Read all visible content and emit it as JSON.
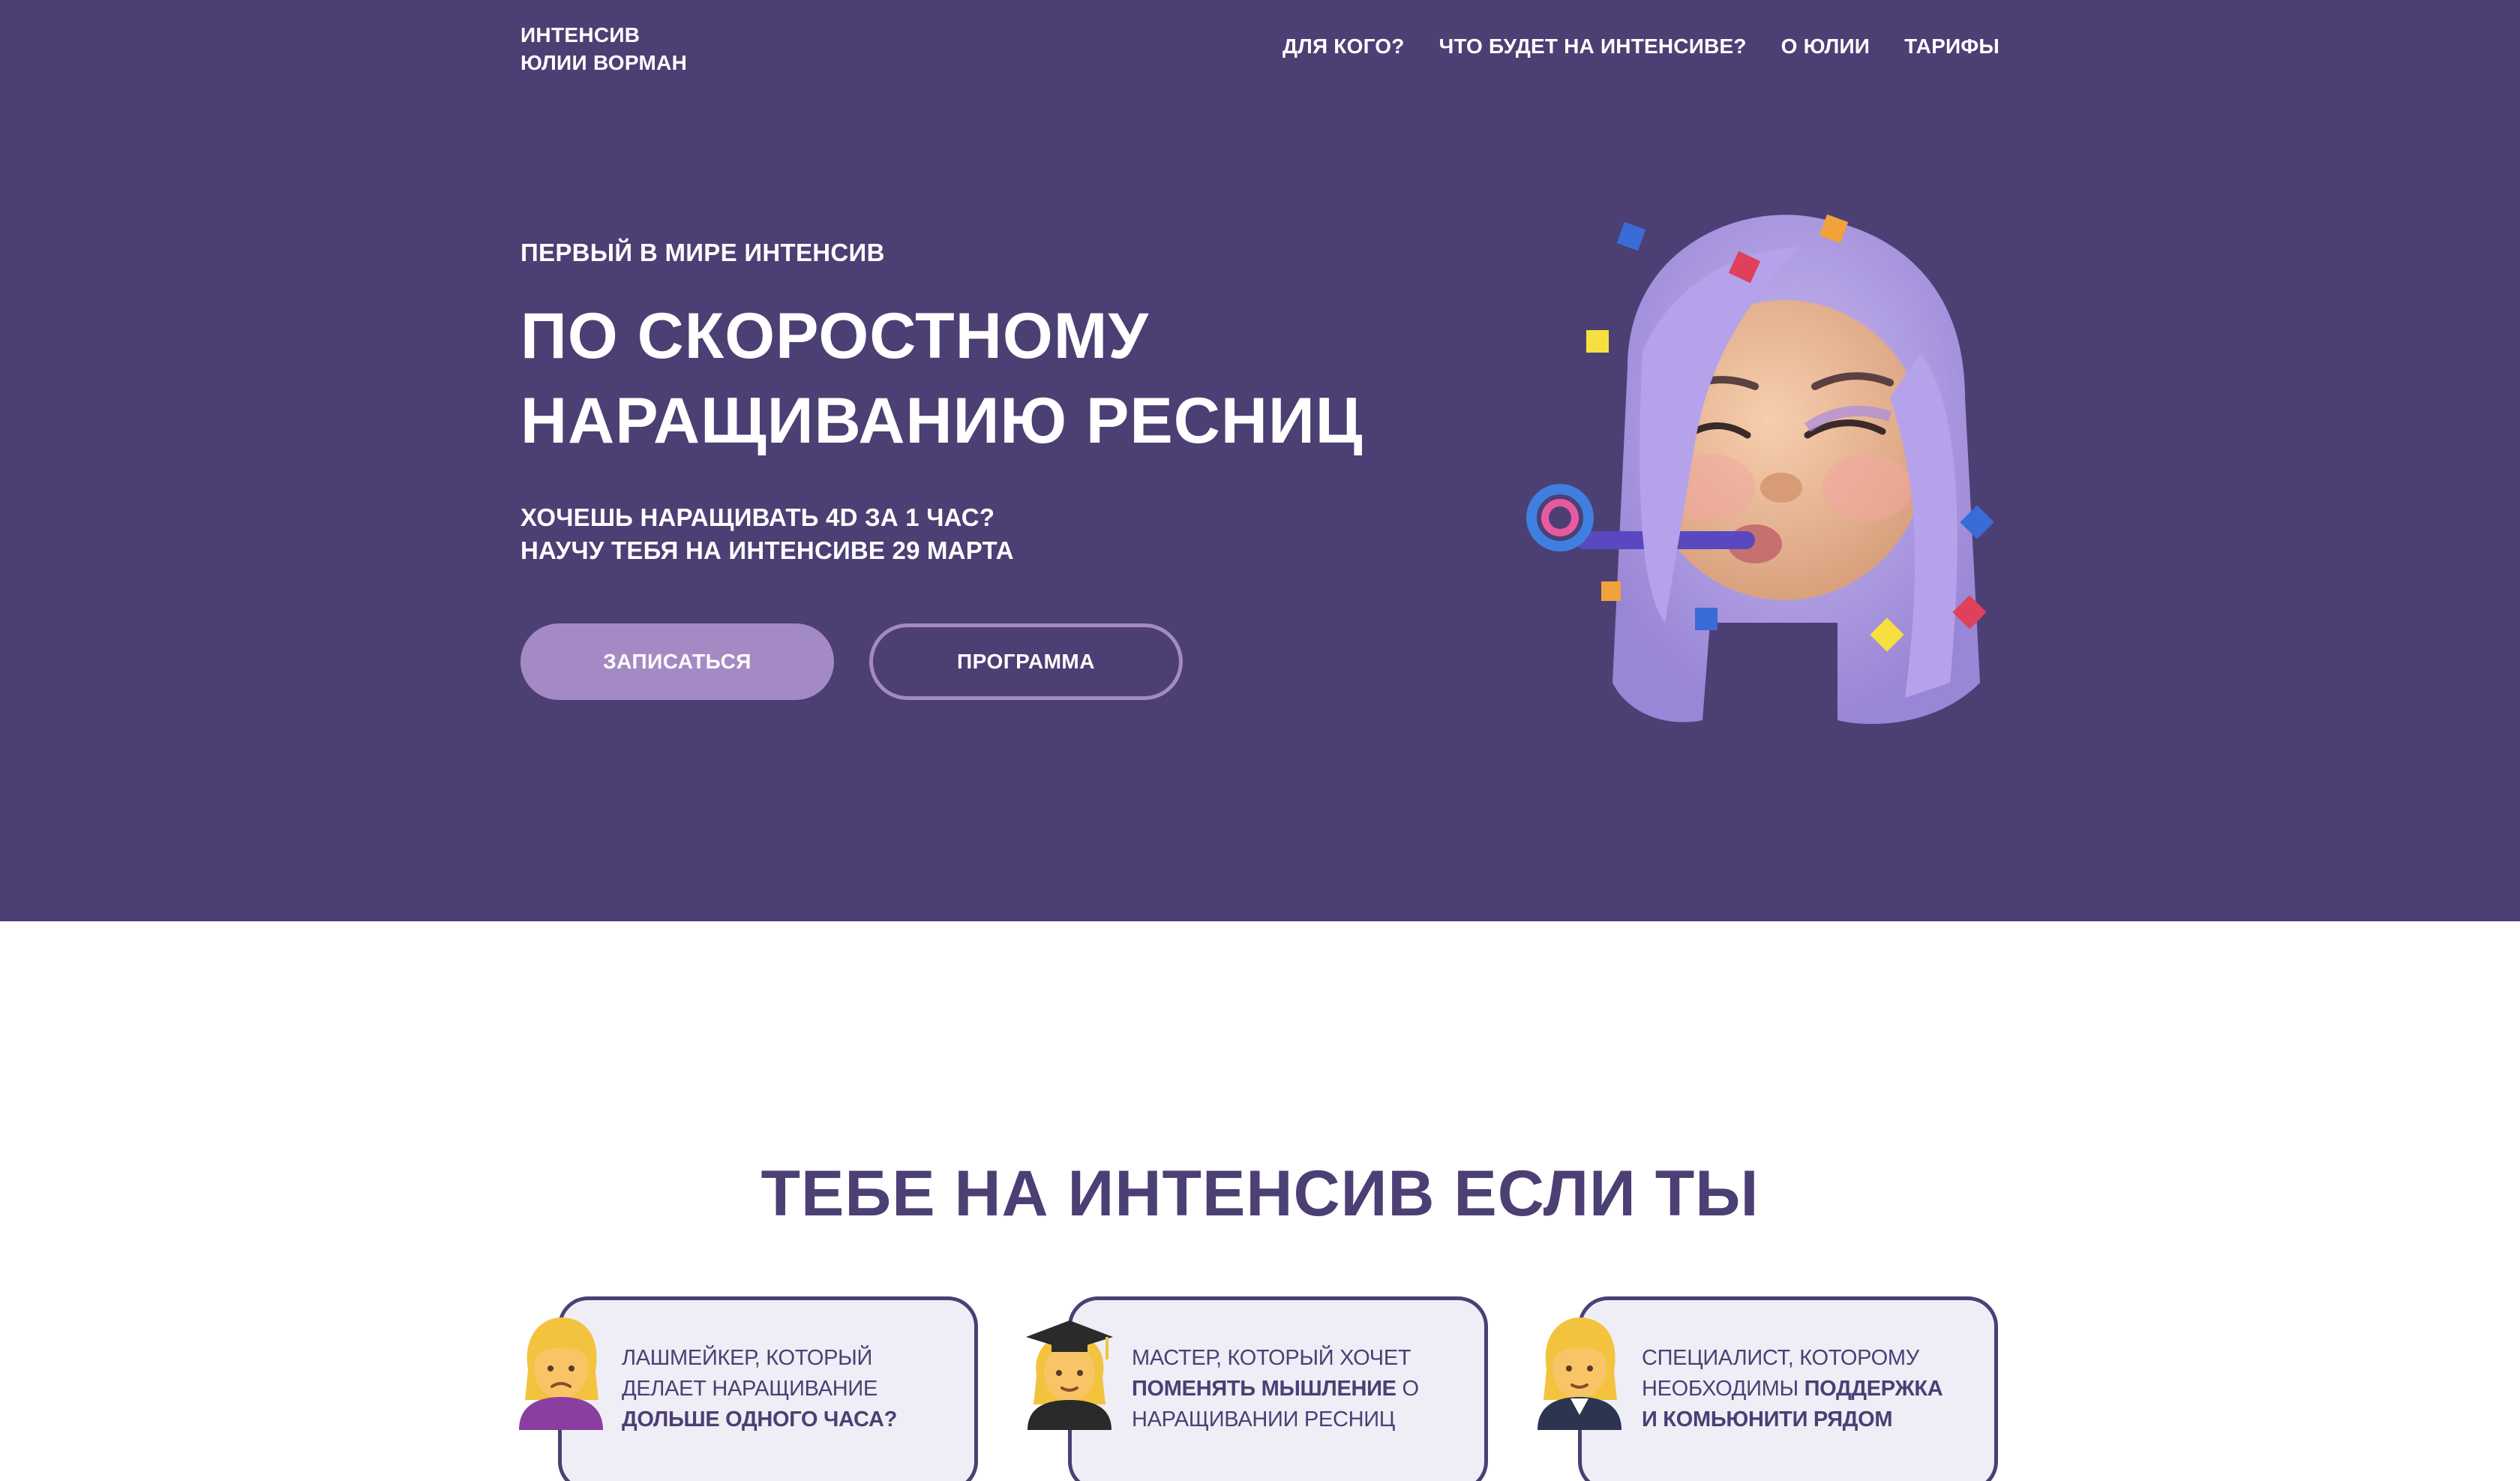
{
  "header": {
    "logo_line1": "ИНТЕНСИВ",
    "logo_line2": "ЮЛИИ ВОРМАН",
    "nav": [
      {
        "label": "ДЛЯ КОГО?"
      },
      {
        "label": "ЧТО БУДЕТ НА ИНТЕНСИВЕ?"
      },
      {
        "label": "О ЮЛИИ"
      },
      {
        "label": "ТАРИФЫ"
      }
    ]
  },
  "hero": {
    "kicker": "ПЕРВЫЙ В МИРЕ ИНТЕНСИВ",
    "headline_line1": "ПО СКОРОСТНОМУ",
    "headline_line2": "НАРАЩИВАНИЮ РЕСНИЦ",
    "sub_line1": "ХОЧЕШЬ НАРАЩИВАТЬ 4D ЗА 1 ЧАС?",
    "sub_line2": "НАУЧУ ТЕБЯ НА ИНТЕНСИВЕ 29 МАРТА",
    "primary_button": "ЗАПИСАТЬСЯ",
    "secondary_button": "ПРОГРАММА",
    "avatar_icon": "memoji-party-avatar"
  },
  "audience": {
    "title": "ТЕБЕ НА ИНТЕНСИВ ЕСЛИ ТЫ",
    "cards": [
      {
        "icon": "woman-frowning-emoji",
        "line1": "ЛАШМЕЙКЕР, КОТОРЫЙ",
        "line2": "ДЕЛАЕТ НАРАЩИВАНИЕ",
        "bold3": "ДОЛЬШЕ ОДНОГО ЧАСА?"
      },
      {
        "icon": "woman-student-emoji",
        "line1": "МАСТЕР, КОТОРЫЙ ХОЧЕТ",
        "bold2": "ПОМЕНЯТЬ МЫШЛЕНИЕ",
        "tail2": " О",
        "line3": "НАРАЩИВАНИИ РЕСНИЦ"
      },
      {
        "icon": "woman-office-worker-emoji",
        "line1": "СПЕЦИАЛИСТ, КОТОРОМУ",
        "line2": "НЕОБХОДИМЫ ",
        "bold2": "ПОДДЕРЖКА",
        "bold3": "И КОМЬЮНИТИ РЯДОМ"
      }
    ]
  },
  "colors": {
    "brand_purple": "#4c3f74",
    "accent_lilac": "#a48ac4",
    "card_bg": "#efedf6"
  }
}
